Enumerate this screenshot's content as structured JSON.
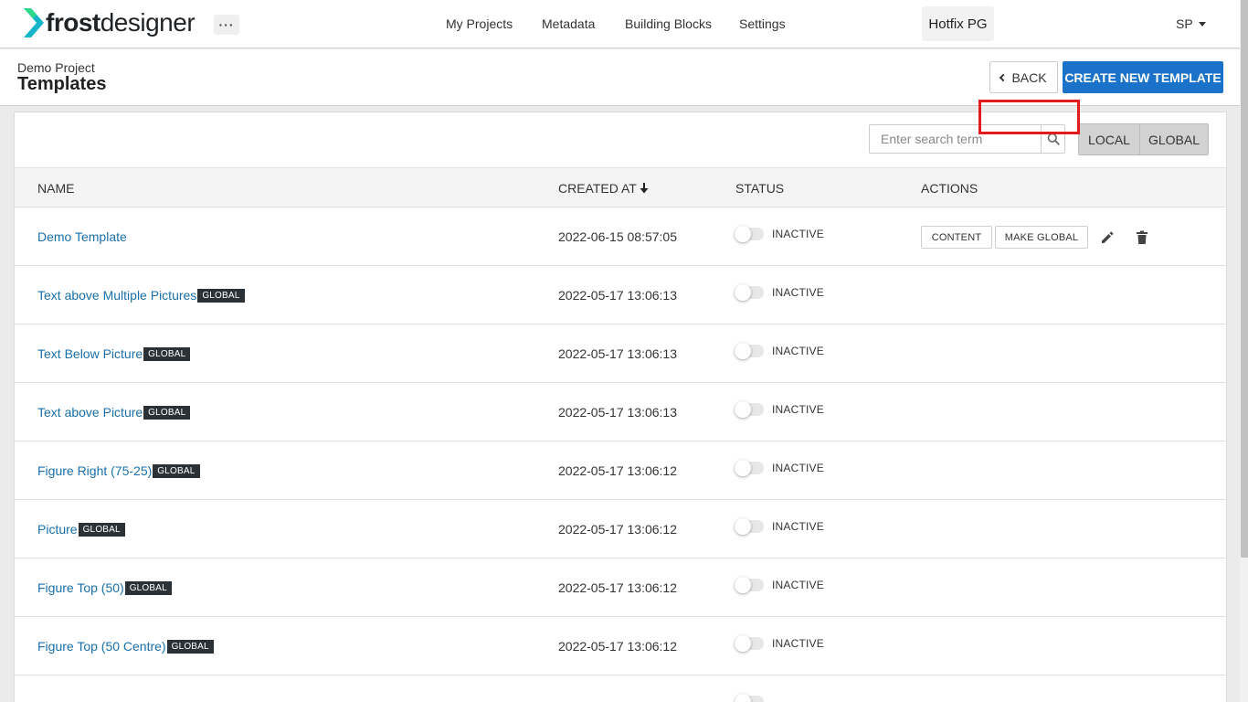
{
  "app": {
    "logo_bold": "frost",
    "logo_regular": "designer",
    "logo_colors": [
      "#2fd98a",
      "#16b4c9"
    ],
    "more_icon": "more-horizontal-icon"
  },
  "nav": {
    "items": [
      {
        "label": "My Projects"
      },
      {
        "label": "Metadata"
      },
      {
        "label": "Building Blocks"
      },
      {
        "label": "Settings"
      }
    ],
    "project": "Hotfix PG",
    "user": "SP"
  },
  "header": {
    "breadcrumb": "Demo Project",
    "title": "Templates",
    "back_label": "BACK",
    "create_label": "CREATE NEW TEMPLATE",
    "accent_color": "#1a73c8"
  },
  "toolbar": {
    "search_placeholder": "Enter search term",
    "scope": [
      "LOCAL",
      "GLOBAL"
    ]
  },
  "table": {
    "columns": {
      "name": "NAME",
      "created_at": "CREATED AT",
      "status": "STATUS",
      "actions": "ACTIONS"
    },
    "rows": [
      {
        "name": "Demo Template",
        "badge": "",
        "created_at": "2022-06-15 08:57:05",
        "status": "INACTIVE",
        "actions": {
          "content": "CONTENT",
          "make_global": "MAKE GLOBAL"
        }
      },
      {
        "name": "Text above Multiple Pictures",
        "badge": "GLOBAL",
        "created_at": "2022-05-17 13:06:13",
        "status": "INACTIVE"
      },
      {
        "name": "Text Below Picture",
        "badge": "GLOBAL",
        "created_at": "2022-05-17 13:06:13",
        "status": "INACTIVE"
      },
      {
        "name": "Text above Picture",
        "badge": "GLOBAL",
        "created_at": "2022-05-17 13:06:13",
        "status": "INACTIVE"
      },
      {
        "name": "Figure Right (75-25)",
        "badge": "GLOBAL",
        "created_at": "2022-05-17 13:06:12",
        "status": "INACTIVE"
      },
      {
        "name": "Picture",
        "badge": "GLOBAL",
        "created_at": "2022-05-17 13:06:12",
        "status": "INACTIVE"
      },
      {
        "name": "Figure Top (50)",
        "badge": "GLOBAL",
        "created_at": "2022-05-17 13:06:12",
        "status": "INACTIVE"
      },
      {
        "name": "Figure Top (50 Centre)",
        "badge": "GLOBAL",
        "created_at": "2022-05-17 13:06:12",
        "status": "INACTIVE"
      }
    ]
  }
}
